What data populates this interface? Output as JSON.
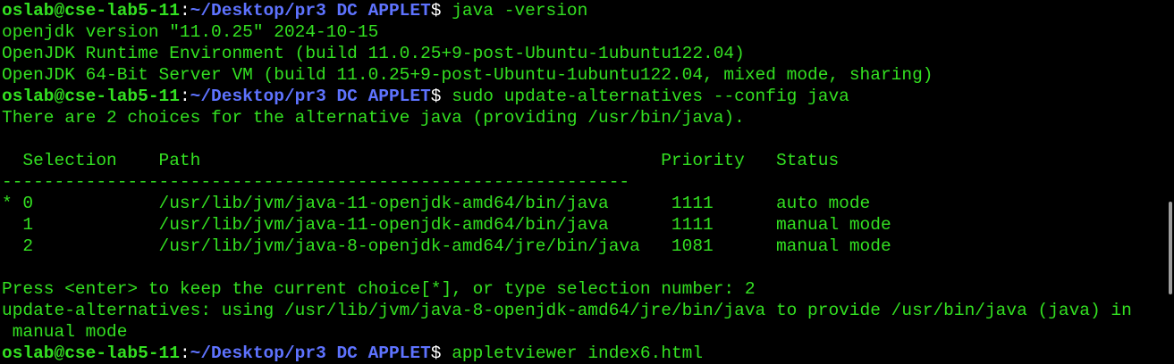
{
  "prompt": {
    "user_host": "oslab@cse-lab5-11",
    "colon": ":",
    "path": "~/Desktop/pr3 DC APPLET",
    "dollar": "$ "
  },
  "commands": {
    "java_version": "java -version",
    "update_alternatives": "sudo update-alternatives --config java",
    "appletviewer": "appletviewer index6.html"
  },
  "output": {
    "line1": "openjdk version \"11.0.25\" 2024-10-15",
    "line2": "OpenJDK Runtime Environment (build 11.0.25+9-post-Ubuntu-1ubuntu122.04)",
    "line3": "OpenJDK 64-Bit Server VM (build 11.0.25+9-post-Ubuntu-1ubuntu122.04, mixed mode, sharing)",
    "line4": "There are 2 choices for the alternative java (providing /usr/bin/java).",
    "header": "  Selection    Path                                            Priority   Status",
    "separator": "------------------------------------------------------------",
    "row0": "* 0            /usr/lib/jvm/java-11-openjdk-amd64/bin/java      1111      auto mode",
    "row1": "  1            /usr/lib/jvm/java-11-openjdk-amd64/bin/java      1111      manual mode",
    "row2": "  2            /usr/lib/jvm/java-8-openjdk-amd64/jre/bin/java   1081      manual mode",
    "press_enter": "Press <enter> to keep the current choice[*], or type selection number: 2",
    "using": "update-alternatives: using /usr/lib/jvm/java-8-openjdk-amd64/jre/bin/java to provide /usr/bin/java (java) in",
    "using_cont": " manual mode"
  },
  "colors": {
    "background": "#000000",
    "text_green": "#33e021",
    "path_blue": "#5e73ff",
    "white": "#ffffff"
  }
}
